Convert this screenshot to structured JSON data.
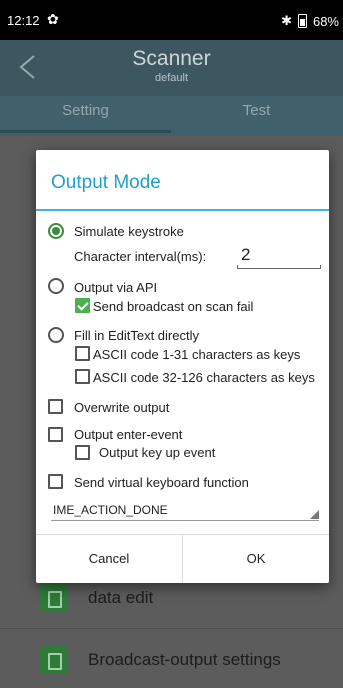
{
  "status": {
    "time": "12:12",
    "bluetooth": "✱",
    "battery_percent": "68%"
  },
  "app": {
    "title": "Scanner",
    "subtitle": "default"
  },
  "tabs": [
    "Setting",
    "Test"
  ],
  "background_items": [
    "data edit",
    "Broadcast-output settings"
  ],
  "dialog": {
    "title": "Output Mode",
    "simulate_keystroke": "Simulate keystroke",
    "char_interval_label": "Character interval(ms):",
    "char_interval_value": "2",
    "output_via_api": "Output via API",
    "send_broadcast": "Send broadcast on scan fail",
    "fill_edittext": "Fill in EditText directly",
    "ascii_1_31": "ASCII code 1-31 characters as keys",
    "ascii_32_126": "ASCII code 32-126 characters as keys",
    "overwrite_output": "Overwrite output",
    "output_enter_event": "Output enter-event",
    "output_key_up": "Output key up event",
    "send_virtual_keyboard": "Send virtual keyboard function",
    "ime_action": "IME_ACTION_DONE",
    "cancel": "Cancel",
    "ok": "OK"
  },
  "colors": {
    "accent": "#22a0c8",
    "check_green": "#4caf50",
    "appbar": "#3c5760"
  }
}
